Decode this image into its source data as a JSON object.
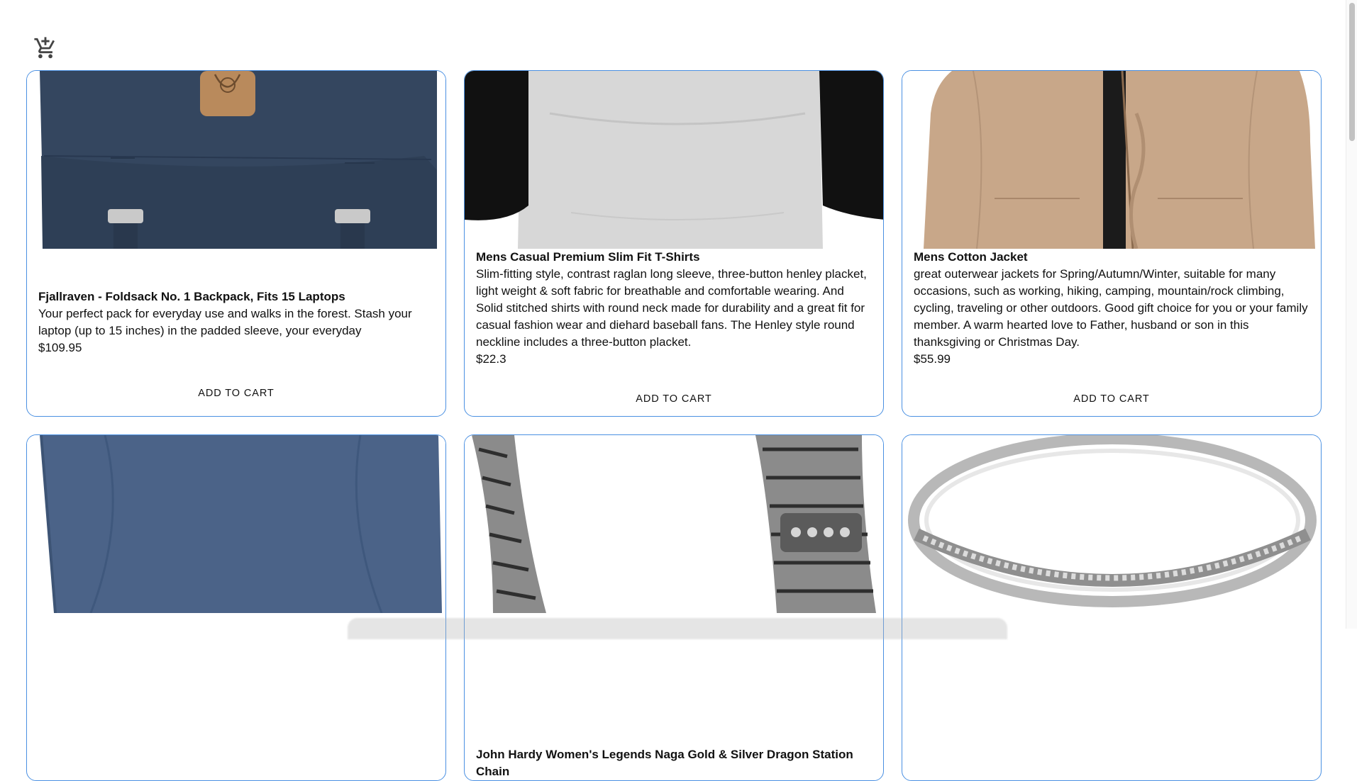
{
  "header": {
    "cart_icon": "add-shopping-cart-icon"
  },
  "products": [
    {
      "title": "Fjallraven - Foldsack No. 1 Backpack, Fits 15 Laptops",
      "description": "Your perfect pack for everyday use and walks in the forest. Stash your laptop (up to 15 inches) in the padded sleeve, your everyday",
      "price": "$109.95",
      "button": "ADD TO CART",
      "image": "navy backpack"
    },
    {
      "title": "Mens Casual Premium Slim Fit T-Shirts",
      "description": "Slim-fitting style, contrast raglan long sleeve, three-button henley placket, light weight & soft fabric for breathable and comfortable wearing. And Solid stitched shirts with round neck made for durability and a great fit for casual fashion wear and diehard baseball fans. The Henley style round neckline includes a three-button placket.",
      "price": "$22.3",
      "button": "ADD TO CART",
      "image": "grey raglan t-shirt"
    },
    {
      "title": "Mens Cotton Jacket",
      "description": "great outerwear jackets for Spring/Autumn/Winter, suitable for many occasions, such as working, hiking, camping, mountain/rock climbing, cycling, traveling or other outdoors. Good gift choice for you or your family member. A warm hearted love to Father, husband or son in this thanksgiving or Christmas Day.",
      "price": "$55.99",
      "button": "ADD TO CART",
      "image": "khaki cotton jacket"
    },
    {
      "title": "",
      "description": "",
      "price": "",
      "button": "",
      "image": "blue long sleeve shirt"
    },
    {
      "title": "John Hardy Women's Legends Naga Gold & Silver Dragon Station Chain",
      "description": "",
      "price": "",
      "button": "",
      "image": "silver chain bracelet"
    },
    {
      "title": "",
      "description": "",
      "price": "",
      "button": "",
      "image": "silver diamond ring"
    }
  ],
  "colors": {
    "card_border": "#4a90e2",
    "backpack": "#34465f",
    "tshirt_body": "#d7d7d7",
    "tshirt_sleeve": "#111111",
    "jacket": "#c8a789",
    "shirt_blue": "#4b6388"
  }
}
